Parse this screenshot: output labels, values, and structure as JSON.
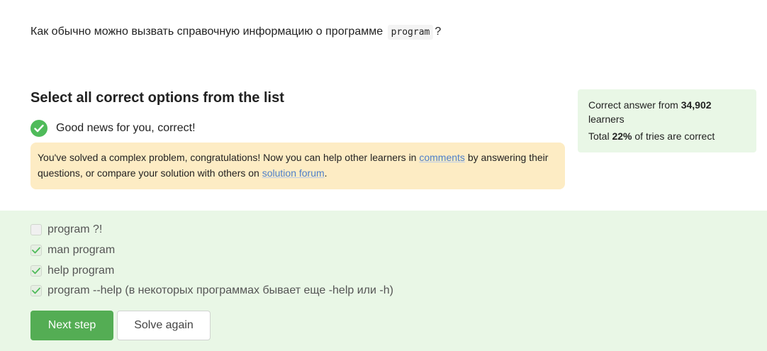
{
  "question": {
    "text_before": "Как обычно можно вызвать справочную информацию о программе",
    "code": "program",
    "text_after": "?"
  },
  "heading": "Select all correct options from the list",
  "feedback": {
    "correct_text": "Good news for you, correct!",
    "notice_part1": "You've solved a complex problem, congratulations! Now you can help other learners in",
    "comments_link": "comments",
    "notice_part2": "by answering their questions, or compare your solution with others on",
    "forum_link": "solution forum",
    "notice_part3": "."
  },
  "stats": {
    "prefix": "Correct answer from",
    "learners_count": "34,902",
    "learners_label": "learners",
    "total_prefix": "Total",
    "percent": "22%",
    "total_suffix": "of tries are correct"
  },
  "options": [
    {
      "label": "program ?!",
      "checked": false
    },
    {
      "label": "man program",
      "checked": true
    },
    {
      "label": "help program",
      "checked": true
    },
    {
      "label": "program --help (в некоторых программах бывает еще -help или -h)",
      "checked": true
    }
  ],
  "buttons": {
    "next_label": "Next step",
    "again_label": "Solve again"
  },
  "colors": {
    "success_green": "#4fbb5a",
    "button_green": "#54ad54",
    "panel_green": "#e9f7e6",
    "notice_yellow": "#fdecc4",
    "link_blue": "#4d7fc9"
  }
}
